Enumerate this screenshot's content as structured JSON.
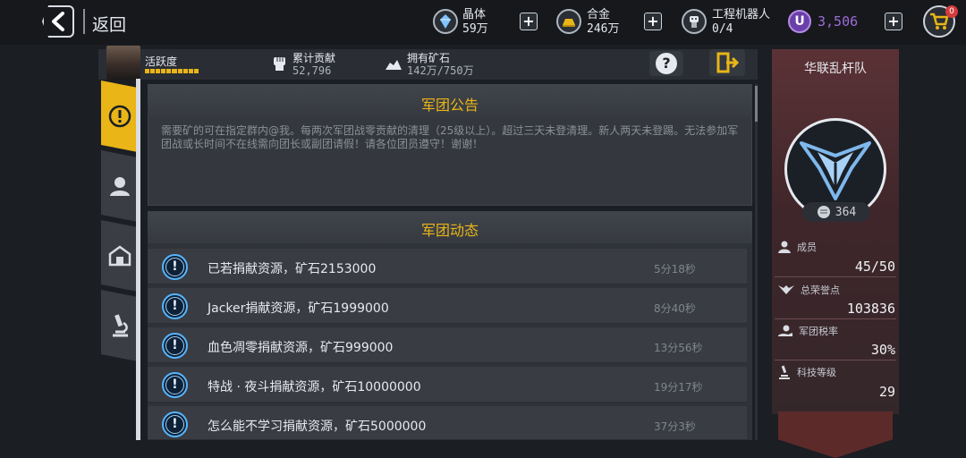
{
  "topbar": {
    "back_label": "返回",
    "resources": [
      {
        "name": "晶体",
        "value": "59万",
        "icon": "crystal-icon"
      },
      {
        "name": "合金",
        "value": "246万",
        "icon": "alloy-icon"
      },
      {
        "name": "工程机器人",
        "value": "0/4",
        "icon": "robot-icon"
      }
    ],
    "currency": {
      "icon_letter": "U",
      "value": "3,506"
    },
    "cart_badge": "0"
  },
  "info": {
    "activity_label": "活跃度",
    "contribution": {
      "label": "累计贡献",
      "value": "52,796"
    },
    "ore": {
      "label": "拥有矿石",
      "value": "142万/750万"
    }
  },
  "notice": {
    "title": "军团公告",
    "text": "需要矿的可在指定群内@我。每两次军团战零贡献的清理（25级以上）。超过三天未登清理。新人两天未登踢。无法参加军团战或长时间不在线需向团长或副团请假！请各位团员遵守！谢谢！"
  },
  "events": {
    "title": "军团动态",
    "rows": [
      {
        "text": "已若捐献资源，矿石2153000",
        "time": "5分18秒"
      },
      {
        "text": "Jacker捐献资源，矿石1999000",
        "time": "8分40秒"
      },
      {
        "text": "血色凋零捐献资源，矿石999000",
        "time": "13分56秒"
      },
      {
        "text": "特战 · 夜斗捐献资源，矿石10000000",
        "time": "19分17秒"
      },
      {
        "text": "怎么能不学习捐献资源，矿石5000000",
        "time": "37分3秒"
      }
    ]
  },
  "legion": {
    "name": "华联乱杆队",
    "points": "364",
    "stats": [
      {
        "label": "成员",
        "value": "45/50",
        "icon": "members-icon"
      },
      {
        "label": "总荣誉点",
        "value": "103836",
        "icon": "honor-wings-icon"
      },
      {
        "label": "军团税率",
        "value": "30%",
        "icon": "tax-hand-icon"
      },
      {
        "label": "科技等级",
        "value": "29",
        "icon": "microscope-icon"
      }
    ]
  },
  "colors": {
    "accent": "#e9b517",
    "event_icon": "#55b6ff",
    "currency": "#9c6cd8",
    "legion_panel": "#5b3236"
  }
}
